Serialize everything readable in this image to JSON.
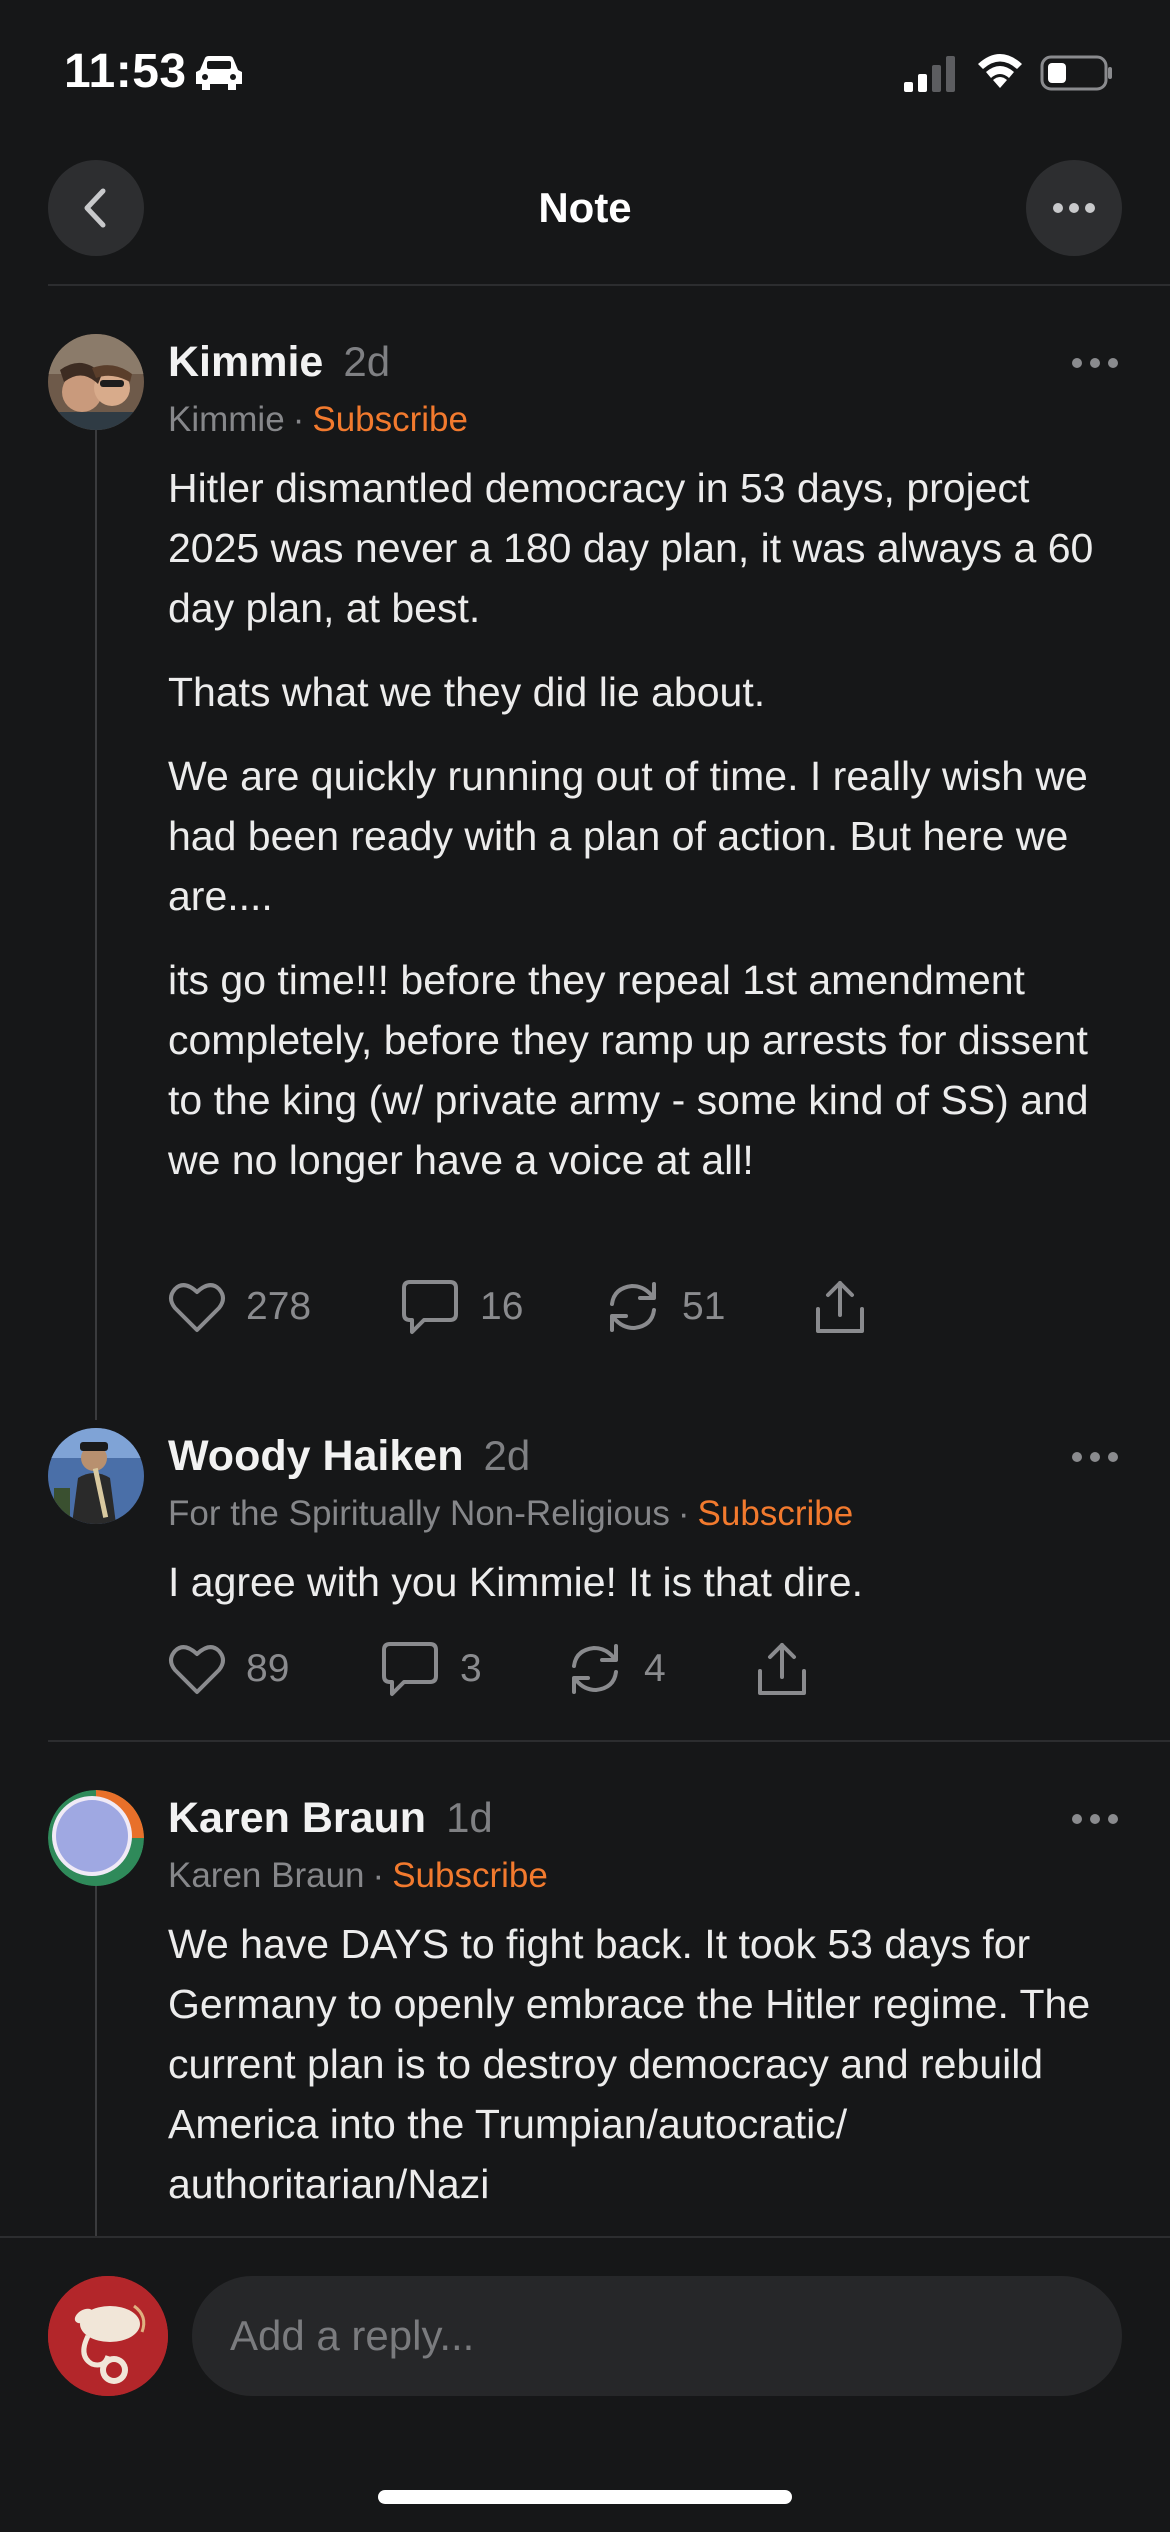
{
  "status_bar": {
    "time": "11:53"
  },
  "header": {
    "title": "Note"
  },
  "posts": [
    {
      "author": "Kimmie",
      "age": "2d",
      "publication": "Kimmie",
      "separator": "·",
      "subscribe_label": "Subscribe",
      "paragraphs": [
        "Hitler dismantled democracy in 53 days, project 2025 was never a 180 day plan, it was always a 60 day plan, at best.",
        "Thats what we they did lie about.",
        "We are quickly running out of time. I really wish we had been ready with a plan of action. But here we are....",
        "its go time!!! before they repeal 1st amendment completely, before they ramp up arrests for dissent to the king (w/ private army - some kind of SS) and we no longer have a voice at all!"
      ],
      "likes": "278",
      "comments": "16",
      "restacks": "51"
    },
    {
      "author": "Woody Haiken",
      "age": "2d",
      "publication": "For the Spiritually Non-Religious",
      "separator": "·",
      "subscribe_label": "Subscribe",
      "paragraphs": [
        "I agree with you Kimmie! It is that dire."
      ],
      "likes": "89",
      "comments": "3",
      "restacks": "4"
    },
    {
      "author": "Karen Braun",
      "age": "1d",
      "publication": "Karen Braun",
      "separator": "·",
      "subscribe_label": "Subscribe",
      "paragraphs": [
        "We have DAYS to fight back. It took 53 days for Germany to openly embrace the Hitler regime. The current plan is to destroy democracy and rebuild America into the Trumpian/autocratic/ authoritarian/Nazi"
      ]
    }
  ],
  "reply": {
    "placeholder": "Add a reply..."
  },
  "colors": {
    "background": "#161718",
    "accent": "#f27a2e",
    "muted": "#86878a"
  },
  "icons": [
    "car-icon",
    "cellular-signal-icon",
    "wifi-icon",
    "battery-icon",
    "chevron-left-icon",
    "ellipsis-icon",
    "heart-icon",
    "comment-icon",
    "restack-icon",
    "share-icon"
  ]
}
